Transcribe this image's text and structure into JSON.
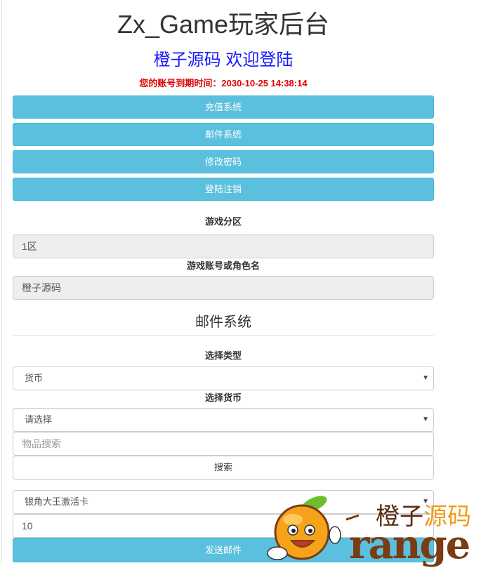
{
  "header": {
    "title": "Zx_Game玩家后台",
    "welcome": "橙子源码 欢迎登陆",
    "expiry": "您的账号到期时间：2030-10-25 14:38:14"
  },
  "nav": {
    "recharge": "充值系统",
    "mail": "邮件系统",
    "change_password": "修改密码",
    "logout": "登陆注销"
  },
  "account": {
    "zone_label": "游戏分区",
    "zone_value": "1区",
    "role_label": "游戏账号或角色名",
    "role_value": "橙子源码"
  },
  "mail": {
    "section_title": "邮件系统",
    "type_label": "选择类型",
    "type_value": "货币",
    "currency_label": "选择货币",
    "currency_value": "请选择",
    "search_placeholder": "物品搜索",
    "search_button": "搜索",
    "item_value": "银角大王激活卡",
    "quantity_value": "10",
    "send_button": "发送邮件"
  },
  "logo": {
    "cn_part1": "橙子",
    "cn_part2": "源码",
    "word": "range"
  },
  "colors": {
    "info_button": "#5bc0de",
    "welcome_text": "#1a1aff",
    "expiry_text": "#e00000"
  }
}
